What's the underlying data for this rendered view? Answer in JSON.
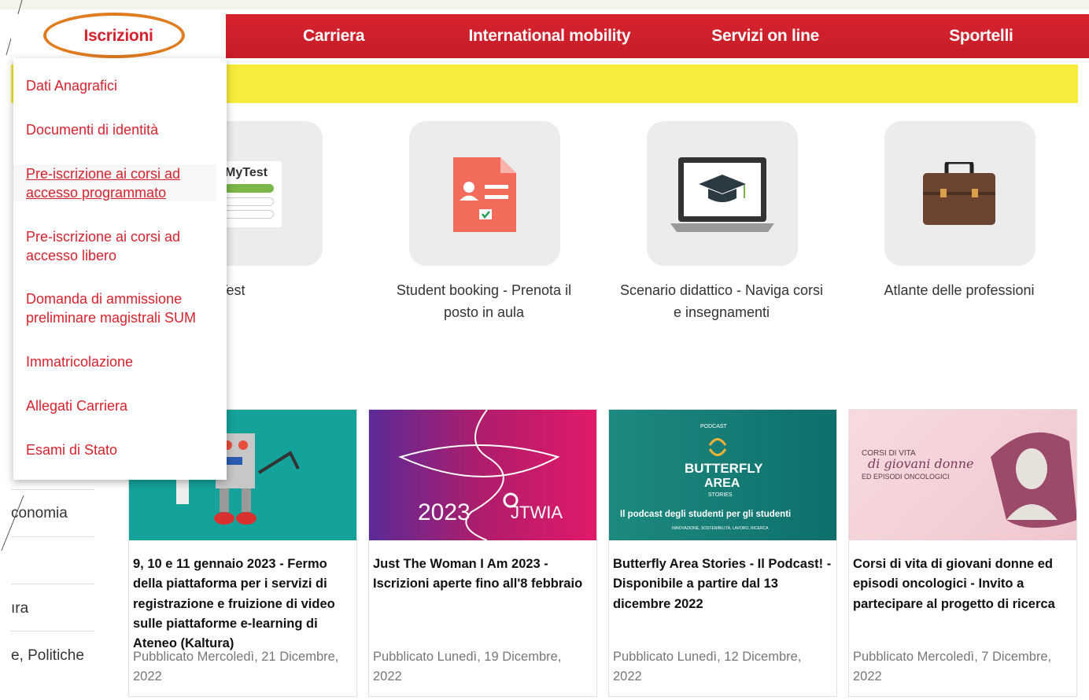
{
  "nav": {
    "items": [
      {
        "label": "Iscrizioni",
        "active": true
      },
      {
        "label": "Carriera"
      },
      {
        "label": "International mobility"
      },
      {
        "label": "Servizi on line"
      },
      {
        "label": "Sportelli"
      }
    ]
  },
  "dropdown": {
    "items": [
      "Dati Anagrafici",
      "Documenti di identità",
      "Pre-iscrizione ai corsi ad accesso programmato",
      "Pre-iscrizione ai corsi ad accesso libero",
      "Domanda di ammissione preliminare magistrali SUM",
      "Immatricolazione",
      "Allegati Carriera",
      "Esami di Stato"
    ]
  },
  "sidebar": {
    "clipped": [
      "conomia",
      "ıra",
      "e, Politiche"
    ]
  },
  "services": {
    "mytest_card_title": "MyTest",
    "items": [
      {
        "label": "MyTest",
        "icon": "mytest-icon"
      },
      {
        "label": "Student booking - Prenota il posto in aula",
        "icon": "document-form-icon"
      },
      {
        "label": "Scenario didattico - Naviga corsi e insegnamenti",
        "icon": "laptop-graduation-icon"
      },
      {
        "label": "Atlante delle professioni",
        "icon": "briefcase-icon"
      }
    ]
  },
  "news": [
    {
      "title": "9, 10 e 11 gennaio 2023 - Fermo della piattaforma per i servizi di registrazione e fruizione di video sulle piattaforme e-learning di Ateneo (Kaltura)",
      "date": "Pubblicato Mercoledì, 21 Dicembre, 2022",
      "image": {
        "text": ""
      }
    },
    {
      "title": "Just The Woman I Am 2023 - Iscrizioni aperte fino all'8 febbraio",
      "date": "Pubblicato Lunedì, 19 Dicembre, 2022",
      "image": {
        "year": "2023",
        "brand": "JTWIA"
      }
    },
    {
      "title": "Butterfly Area Stories - Il  Podcast! - Disponibile a partire dal 13 dicembre 2022",
      "date": "Pubblicato Lunedì, 12 Dicembre, 2022",
      "image": {
        "kicker": "PODCAST",
        "line1": "BUTTERFLY",
        "line2": "AREA",
        "line3": "STORIES",
        "tagline": "Il podcast degli studenti per gli studenti",
        "subtag": "INNOVAZIONE, SOSTENIBILITÀ, LAVORO, RICERCA"
      }
    },
    {
      "title": "Corsi di vita di giovani donne ed episodi oncologici - Invito a partecipare al progetto di ricerca",
      "date": "Pubblicato Mercoledì, 7 Dicembre, 2022",
      "image": {
        "line1": "CORSI DI VITA",
        "line2": "di giovani donne",
        "line3": "ED EPISODI ONCOLOGICI"
      }
    }
  ],
  "colors": {
    "brand_red": "#d8232e",
    "banner_yellow": "#f7ec3b",
    "ring_orange": "#e07b20"
  }
}
